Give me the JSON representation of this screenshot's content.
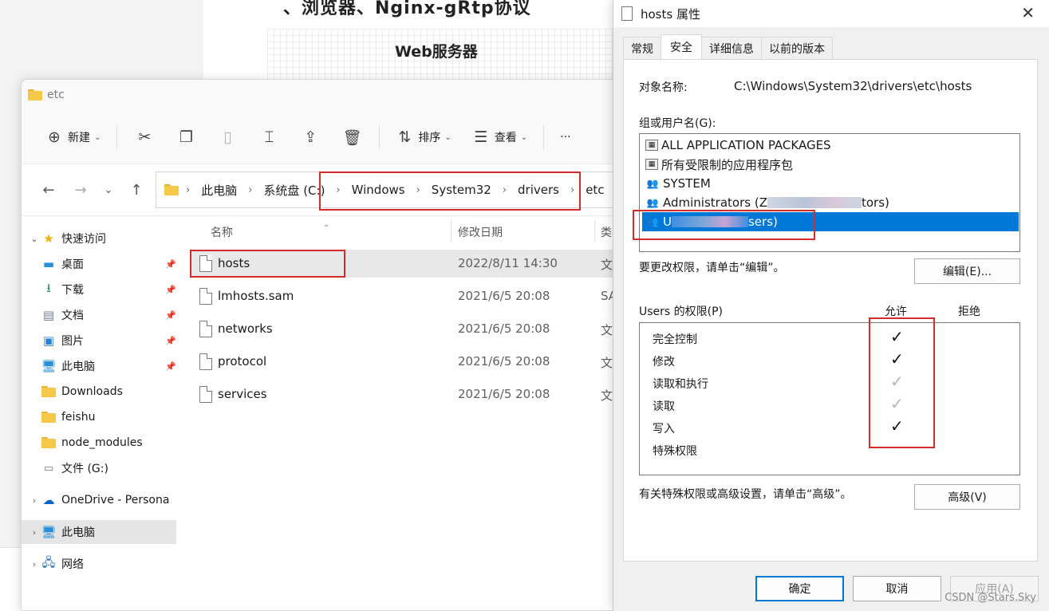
{
  "background": {
    "heading": "、浏览器、Nginx-gRtp协议",
    "subheading": "Web服务器"
  },
  "explorer": {
    "title": "etc",
    "toolbar": {
      "new_label": "新建",
      "sort_label": "排序",
      "view_label": "查看",
      "more_label": "···"
    },
    "breadcrumbs": [
      "此电脑",
      "系统盘 (C:)",
      "Windows",
      "System32",
      "drivers",
      "etc"
    ],
    "sidebar": {
      "quick_access": "快速访问",
      "items": [
        {
          "label": "桌面",
          "icon": "desktop-icon",
          "pinned": true
        },
        {
          "label": "下载",
          "icon": "download-icon",
          "pinned": true
        },
        {
          "label": "文档",
          "icon": "document-icon",
          "pinned": true
        },
        {
          "label": "图片",
          "icon": "picture-icon",
          "pinned": true
        },
        {
          "label": "此电脑",
          "icon": "computer-icon",
          "pinned": true
        },
        {
          "label": "Downloads",
          "icon": "folder-icon",
          "pinned": false
        },
        {
          "label": "feishu",
          "icon": "folder-icon",
          "pinned": false
        },
        {
          "label": "node_modules",
          "icon": "folder-icon",
          "pinned": false
        },
        {
          "label": "文件 (G:)",
          "icon": "drive-icon",
          "pinned": false
        }
      ],
      "onedrive": "OneDrive - Persona",
      "this_pc": "此电脑",
      "network": "网络"
    },
    "columns": {
      "name": "名称",
      "modified": "修改日期",
      "type": "类"
    },
    "files": [
      {
        "name": "hosts",
        "modified": "2022/8/11 14:30",
        "type": "文",
        "selected": true
      },
      {
        "name": "lmhosts.sam",
        "modified": "2021/6/5 20:08",
        "type": "SA",
        "selected": false
      },
      {
        "name": "networks",
        "modified": "2021/6/5 20:08",
        "type": "文",
        "selected": false
      },
      {
        "name": "protocol",
        "modified": "2021/6/5 20:08",
        "type": "文",
        "selected": false
      },
      {
        "name": "services",
        "modified": "2021/6/5 20:08",
        "type": "文",
        "selected": false
      }
    ]
  },
  "dialog": {
    "title": "hosts 属性",
    "tabs": [
      {
        "label": "常规",
        "active": false
      },
      {
        "label": "安全",
        "active": true
      },
      {
        "label": "详细信息",
        "active": false
      },
      {
        "label": "以前的版本",
        "active": false
      }
    ],
    "object_name_label": "对象名称:",
    "object_name_value": "C:\\Windows\\System32\\drivers\\etc\\hosts",
    "groups_label": "组或用户名(G):",
    "users": [
      {
        "label": "ALL APPLICATION PACKAGES",
        "icon": "package-icon",
        "selected": false
      },
      {
        "label": "所有受限制的应用程序包",
        "icon": "package-icon",
        "selected": false
      },
      {
        "label": "SYSTEM",
        "icon": "users-icon",
        "selected": false
      },
      {
        "label_prefix": "Administrators (Z",
        "label_suffix": "tors)",
        "icon": "users-icon",
        "selected": false
      },
      {
        "label_prefix": "U",
        "label_suffix": "sers)",
        "icon": "users-icon",
        "selected": true
      }
    ],
    "edit_hint": "要更改权限，请单击“编辑”。",
    "edit_button": "编辑(E)...",
    "perm_title": "Users 的权限(P)",
    "allow_label": "允许",
    "deny_label": "拒绝",
    "permissions": [
      {
        "name": "完全控制",
        "allow": true,
        "inherited": false
      },
      {
        "name": "修改",
        "allow": true,
        "inherited": false
      },
      {
        "name": "读取和执行",
        "allow": true,
        "inherited": true
      },
      {
        "name": "读取",
        "allow": true,
        "inherited": true
      },
      {
        "name": "写入",
        "allow": true,
        "inherited": false
      },
      {
        "name": "特殊权限",
        "allow": false,
        "inherited": false
      }
    ],
    "advanced_hint": "有关特殊权限或高级设置，请单击“高级”。",
    "advanced_button": "高级(V)",
    "ok_button": "确定",
    "cancel_button": "取消",
    "apply_button": "应用(A)"
  },
  "watermark": "CSDN @Stars.Sky",
  "colors": {
    "accent": "#0078d7",
    "annotation": "#d42b2b",
    "folder": "#f7c948"
  }
}
